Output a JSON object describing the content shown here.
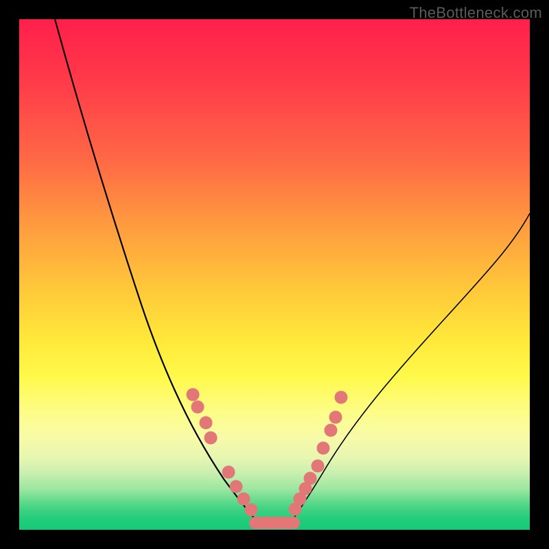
{
  "watermark": "TheBottleneck.com",
  "chart_data": {
    "type": "line",
    "title": "",
    "xlabel": "",
    "ylabel": "",
    "xlim": [
      0,
      100
    ],
    "ylim": [
      0,
      100
    ],
    "grid": false,
    "legend": false,
    "background_gradient": {
      "top": "#ff1f4b",
      "bottom": "#16c978",
      "meaning": "red = high bottleneck, green = low bottleneck"
    },
    "series": [
      {
        "name": "bottleneck-curve-left",
        "x": [
          7,
          12,
          18,
          24,
          30,
          36,
          40,
          44,
          47
        ],
        "y": [
          100,
          82,
          62,
          44,
          30,
          18,
          10,
          4,
          1
        ]
      },
      {
        "name": "bottleneck-curve-right",
        "x": [
          53,
          56,
          60,
          66,
          74,
          84,
          94,
          100
        ],
        "y": [
          1,
          4,
          10,
          19,
          31,
          44,
          56,
          62
        ]
      },
      {
        "name": "optimal-plateau",
        "x": [
          47,
          48,
          49,
          50,
          51,
          52,
          53
        ],
        "y": [
          1,
          1,
          1,
          1,
          1,
          1,
          1
        ]
      }
    ],
    "scatter": [
      {
        "name": "markers-left-upper",
        "x": [
          34,
          35,
          36.5,
          37.5
        ],
        "y": [
          26.5,
          24,
          21,
          18
        ]
      },
      {
        "name": "markers-left-lower",
        "x": [
          41,
          42.5,
          44,
          45.5
        ],
        "y": [
          11,
          8.5,
          6,
          4
        ]
      },
      {
        "name": "markers-right-lower",
        "x": [
          54,
          55,
          56,
          57,
          58.5
        ],
        "y": [
          4,
          6,
          8,
          10,
          12.5
        ]
      },
      {
        "name": "markers-right-upper",
        "x": [
          59.5,
          61,
          62,
          63
        ],
        "y": [
          16,
          19.5,
          22,
          26
        ]
      }
    ],
    "annotations": []
  }
}
